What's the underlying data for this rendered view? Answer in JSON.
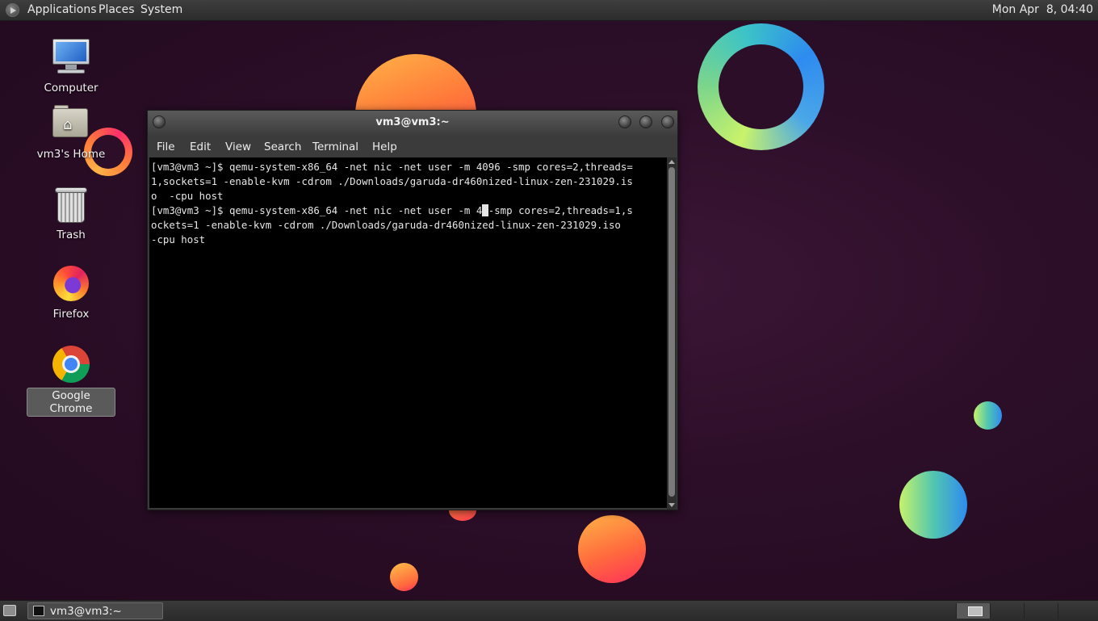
{
  "top_panel": {
    "menus": [
      "Applications",
      "Places",
      "System"
    ],
    "clock": "Mon Apr  8, 04:40"
  },
  "desktop_icons": [
    {
      "label": "Computer",
      "icon": "computer-icon"
    },
    {
      "label": "vm3's Home",
      "icon": "home-folder-icon"
    },
    {
      "label": "Trash",
      "icon": "trash-icon"
    },
    {
      "label": "Firefox",
      "icon": "firefox-icon"
    },
    {
      "label": "Google Chrome",
      "icon": "chrome-icon",
      "selected": true
    }
  ],
  "terminal": {
    "title": "vm3@vm3:~",
    "menus": [
      "File",
      "Edit",
      "View",
      "Search",
      "Terminal",
      "Help"
    ],
    "lines": [
      "[vm3@vm3 ~]$ qemu-system-x86_64 -net nic -net user -m 4096 -smp cores=2,threads=",
      "1,sockets=1 -enable-kvm -cdrom ./Downloads/garuda-dr460nized-linux-zen-231029.is",
      "o  -cpu host",
      "-cpu host"
    ],
    "line4_before_cursor": "[vm3@vm3 ~]$ qemu-system-x86_64 -net nic -net user -m 4",
    "line4_cursor_char": " ",
    "line4_after_cursor": "-smp cores=2,threads=1,s",
    "line5": "ockets=1 -enable-kvm -cdrom ./Downloads/garuda-dr460nized-linux-zen-231029.iso"
  },
  "taskbar": {
    "task_label": "vm3@vm3:~"
  },
  "colors": {
    "panel": "#2c2c2c",
    "desktop_bg": "#2c0e28",
    "terminal_bg": "#000000",
    "terminal_fg": "#e6e6e6"
  }
}
